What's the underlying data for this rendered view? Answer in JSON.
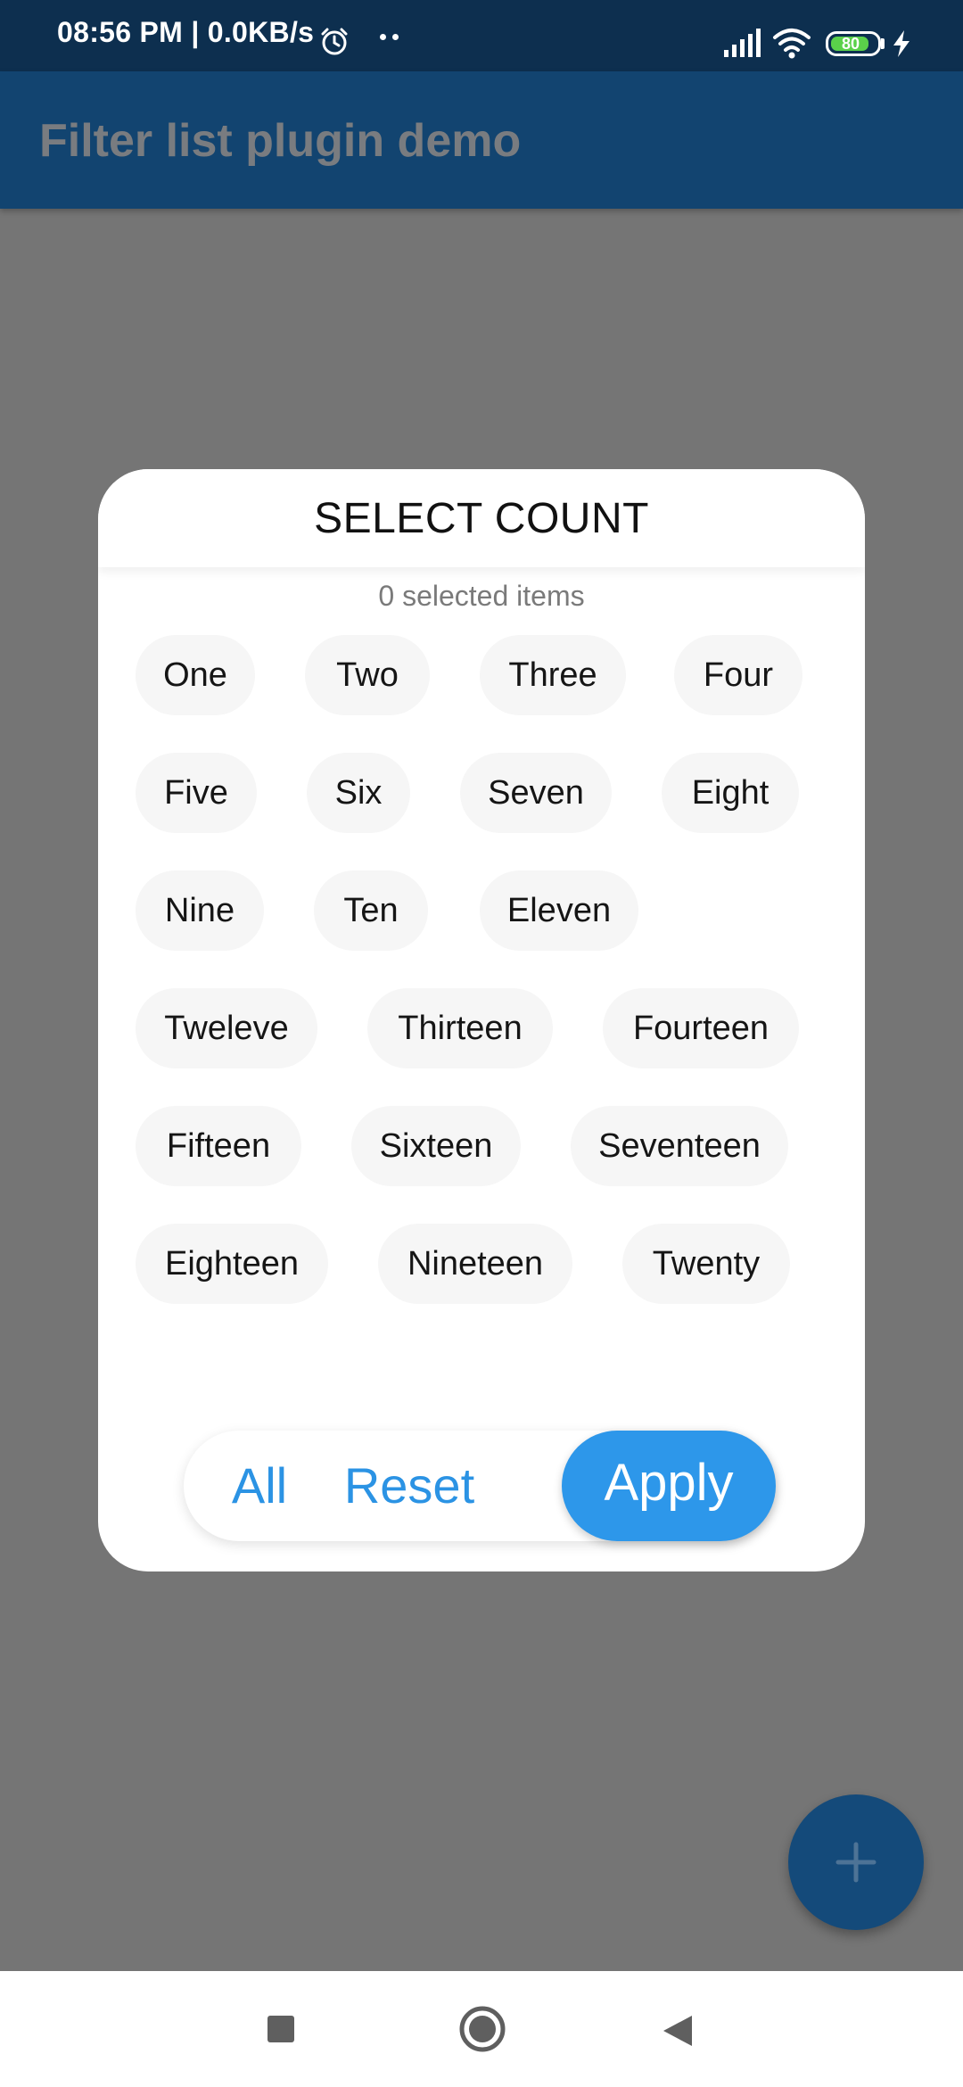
{
  "status_bar": {
    "time": "08:56 PM | 0.0KB/s",
    "battery_level": "80",
    "icons": [
      "alarm-icon",
      "more-dots-icon",
      "signal-icon",
      "wifi-icon",
      "battery-icon",
      "charging-icon"
    ]
  },
  "app_bar": {
    "title": "Filter list plugin demo"
  },
  "dialog": {
    "title": "SELECT COUNT",
    "selected_count": "0 selected items",
    "chips": [
      "One",
      "Two",
      "Three",
      "Four",
      "Five",
      "Six",
      "Seven",
      "Eight",
      "Nine",
      "Ten",
      "Eleven",
      "Tweleve",
      "Thirteen",
      "Fourteen",
      "Fifteen",
      "Sixteen",
      "Seventeen",
      "Eighteen",
      "Nineteen",
      "Twenty"
    ],
    "actions": {
      "all_label": "All",
      "reset_label": "Reset",
      "apply_label": "Apply"
    }
  },
  "fab": {
    "icon": "plus-icon"
  },
  "nav_bar": {
    "icons": [
      "recents-icon",
      "home-icon",
      "back-icon"
    ]
  },
  "colors": {
    "status_bar": "#0d2f4f",
    "app_bar": "#124470",
    "scrim": "#757575",
    "accent": "#2d97ea",
    "chip_background": "#f6f6f6",
    "battery_fill": "#5ad14a"
  }
}
